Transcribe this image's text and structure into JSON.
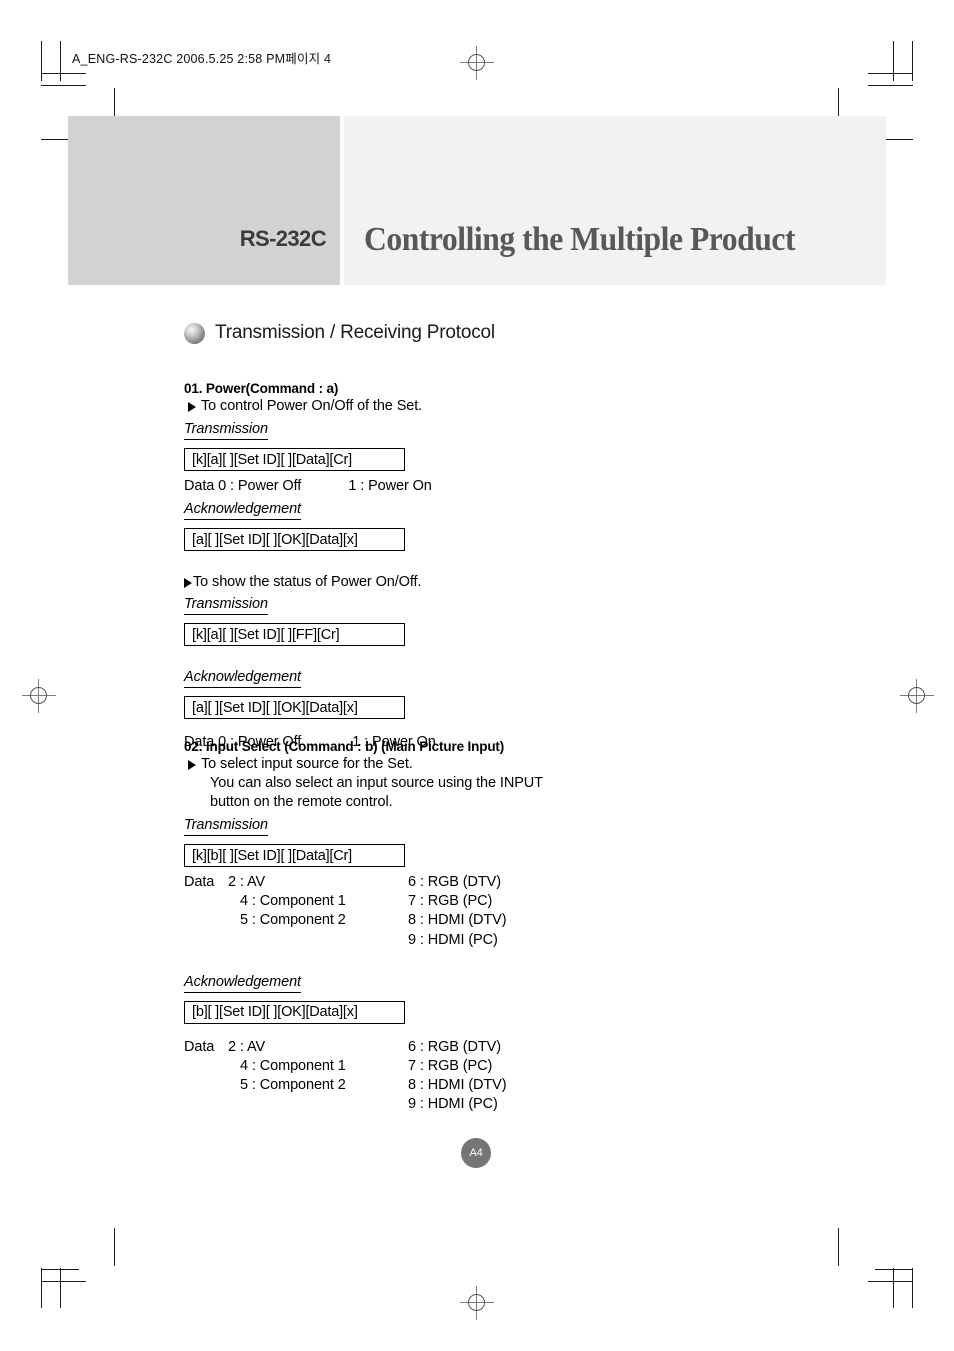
{
  "running_head": "A_ENG-RS-232C  2006.5.25  2:58 PM페이지 4",
  "banner": {
    "left_label": "RS-232C",
    "title": "Controlling the Multiple Product"
  },
  "protocol_heading": "Transmission / Receiving Protocol",
  "sections": [
    {
      "title": "01. Power(Command : a)",
      "bullet1": "To control Power On/Off of the Set.",
      "transmission_label": "Transmission",
      "transmission_code": "[k][a][ ][Set ID][ ][Data][Cr]",
      "data_line1": "Data 0 : Power Off            1 : Power On",
      "ack_label_1": "Acknowledgement",
      "ack_code_1": "[a][ ][Set ID][ ][OK][Data][x]",
      "bullet2": "To show the status of Power On/Off.",
      "transmission_label_2": "Transmission",
      "transmission_code_2": "[k][a][ ][Set ID][ ][FF][Cr]",
      "ack_label_2": "Acknowledgement",
      "ack_code_2": "[a][ ][Set ID][ ][OK][Data][x]",
      "data_line2": "Data 0 : Power Off             1 : Power On"
    },
    {
      "title": "02. Input Select (Command : b) (Main Picture Input)",
      "bullet1": "To select input source for the Set.",
      "bullet1_cont_a": "You can also select an input source using the INPUT",
      "bullet1_cont_b": "button on the remote control.",
      "transmission_label": "Transmission",
      "transmission_code": "[k][b][ ][Set ID][ ][Data][Cr]",
      "data_table_1": {
        "lead": "Data",
        "rows": [
          {
            "left": "2 : AV",
            "right": "6 : RGB (DTV)"
          },
          {
            "left": "4 : Component 1",
            "right": "7 : RGB (PC)"
          },
          {
            "left": "5 : Component 2",
            "right": "8 : HDMI (DTV)"
          },
          {
            "left": "",
            "right": "9 : HDMI (PC)"
          }
        ]
      },
      "ack_label": "Acknowledgement",
      "ack_code": "[b][ ][Set ID][ ][OK][Data][x]",
      "data_table_2": {
        "lead": "Data",
        "rows": [
          {
            "left": "2 : AV",
            "right": "6 : RGB (DTV)"
          },
          {
            "left": "4 : Component 1",
            "right": "7 : RGB (PC)"
          },
          {
            "left": "5 : Component 2",
            "right": "8 : HDMI (DTV)"
          },
          {
            "left": "",
            "right": "9 : HDMI (PC)"
          }
        ]
      }
    }
  ],
  "page_badge": "A4",
  "colors": {
    "banner_left_bg": "#d2d2d2",
    "banner_right_bg": "#f2f2f2",
    "title_text": "#585858",
    "badge_bg": "#757575"
  }
}
